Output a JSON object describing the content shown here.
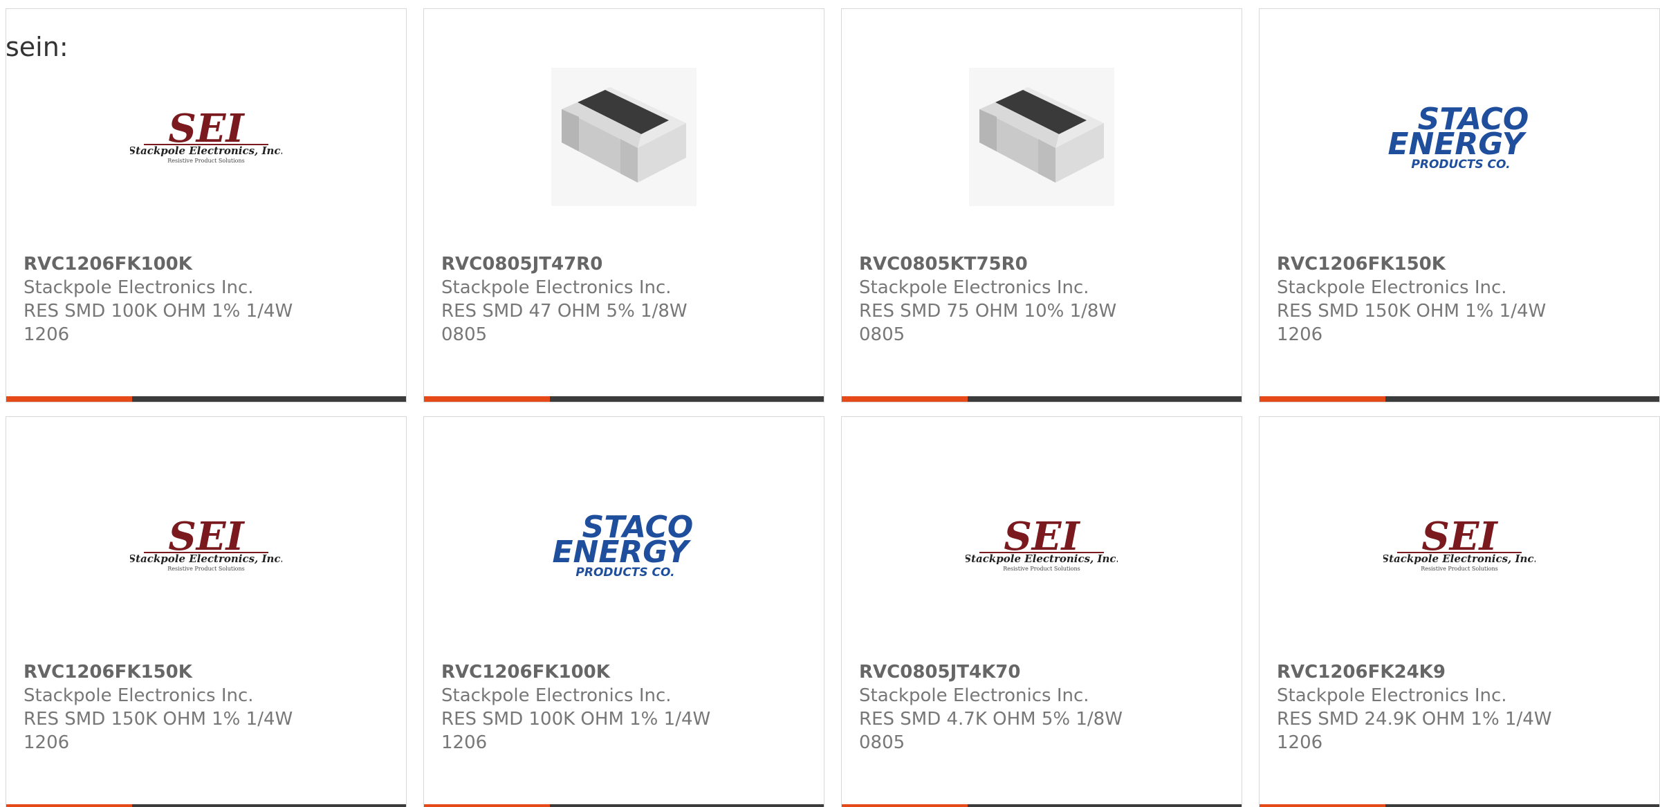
{
  "intro_text": "sein:",
  "colors": {
    "accent_bar": "#e64a19",
    "dark_bar": "#3c3c3c",
    "sei_logo": "#7a1a1e",
    "staco_logo": "#1f4f9c"
  },
  "cards": [
    {
      "part_number": "RVC1206FK100K",
      "manufacturer": "Stackpole Electronics Inc.",
      "description": "RES SMD 100K OHM 1% 1/4W 1206",
      "image": "sei-logo",
      "logo_text": "SEI",
      "logo_subtitle": "Stackpole Electronics, Inc.",
      "logo_tagline": "Resistive Product Solutions"
    },
    {
      "part_number": "RVC0805JT47R0",
      "manufacturer": "Stackpole Electronics Inc.",
      "description": "RES SMD 47 OHM 5% 1/8W 0805",
      "image": "smd-resistor-chip"
    },
    {
      "part_number": "RVC0805KT75R0",
      "manufacturer": "Stackpole Electronics Inc.",
      "description": "RES SMD 75 OHM 10% 1/8W 0805",
      "image": "smd-resistor-chip"
    },
    {
      "part_number": "RVC1206FK150K",
      "manufacturer": "Stackpole Electronics Inc.",
      "description": "RES SMD 150K OHM 1% 1/4W 1206",
      "image": "staco-energy-logo",
      "logo_text": "STACO",
      "logo_subtitle": "ENERGY",
      "logo_tagline": "PRODUCTS CO."
    },
    {
      "part_number": "RVC1206FK150K",
      "manufacturer": "Stackpole Electronics Inc.",
      "description": "RES SMD 150K OHM 1% 1/4W 1206",
      "image": "sei-logo",
      "logo_text": "SEI",
      "logo_subtitle": "Stackpole Electronics, Inc.",
      "logo_tagline": "Resistive Product Solutions"
    },
    {
      "part_number": "RVC1206FK100K",
      "manufacturer": "Stackpole Electronics Inc.",
      "description": "RES SMD 100K OHM 1% 1/4W 1206",
      "image": "staco-energy-logo",
      "logo_text": "STACO",
      "logo_subtitle": "ENERGY",
      "logo_tagline": "PRODUCTS CO."
    },
    {
      "part_number": "RVC0805JT4K70",
      "manufacturer": "Stackpole Electronics Inc.",
      "description": "RES SMD 4.7K OHM 5% 1/8W 0805",
      "image": "sei-logo",
      "logo_text": "SEI",
      "logo_subtitle": "Stackpole Electronics, Inc.",
      "logo_tagline": "Resistive Product Solutions"
    },
    {
      "part_number": "RVC1206FK24K9",
      "manufacturer": "Stackpole Electronics Inc.",
      "description": "RES SMD 24.9K OHM 1% 1/4W 1206",
      "image": "sei-logo",
      "logo_text": "SEI",
      "logo_subtitle": "Stackpole Electronics, Inc.",
      "logo_tagline": "Resistive Product Solutions"
    }
  ]
}
